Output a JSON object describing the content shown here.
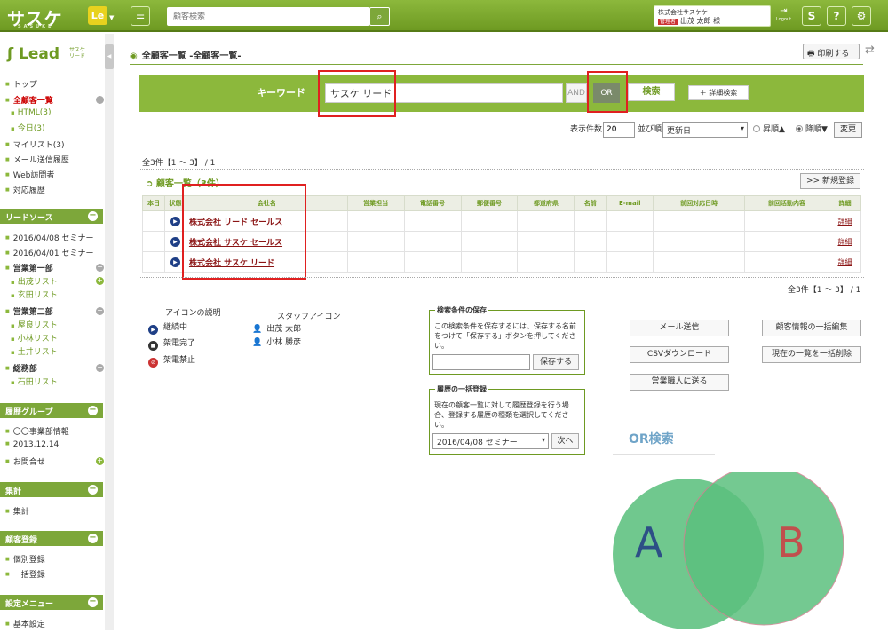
{
  "app": {
    "logo": "サスケ",
    "logo_sub": "SASUKE",
    "le_badge": "Le",
    "search_placeholder": "顧客検索"
  },
  "user": {
    "company": "株式会社サスケケ",
    "role_badge": "管理者",
    "name": "出茂 太郎 様",
    "logout": "Logout"
  },
  "top_icons": [
    "S",
    "?",
    "⚙"
  ],
  "sidebar": {
    "lead_logo": "Lead",
    "lead_logo_sub": "サスケ リード",
    "items": [
      {
        "label": "トップ"
      },
      {
        "label": "全顧客一覧"
      },
      {
        "label": "HTML(3)"
      },
      {
        "label": "今日(3)"
      },
      {
        "label": "マイリスト(3)"
      },
      {
        "label": "メール送信履歴"
      },
      {
        "label": "Web訪問者"
      },
      {
        "label": "対応履歴"
      }
    ],
    "sections": [
      {
        "title": "リードソース",
        "items": [
          "2016/04/08 セミナー",
          "2016/04/01 セミナー",
          "営業第一部",
          "出茂リスト",
          "玄田リスト",
          "営業第二部",
          "屋良リスト",
          "小林リスト",
          "土井リスト",
          "総務部",
          "石田リスト"
        ]
      },
      {
        "title": "履歴グループ",
        "items": [
          "〇〇事業部情報",
          "2013.12.14",
          "お問合せ"
        ]
      },
      {
        "title": "集計",
        "items": [
          "集計"
        ]
      },
      {
        "title": "顧客登録",
        "items": [
          "個別登録",
          "一括登録"
        ]
      },
      {
        "title": "設定メニュー",
        "items": [
          "基本設定"
        ]
      }
    ]
  },
  "page": {
    "title": "全顧客一覧 -全顧客一覧-",
    "print": "印刷する"
  },
  "search": {
    "label": "キーワード",
    "value": "サスケ リード",
    "and": "AND",
    "or": "OR",
    "submit": "検索",
    "advanced": "＋ 詳細検索"
  },
  "options": {
    "count_label": "表示件数",
    "count_value": "20",
    "sort_label": "並び順",
    "sort_value": "更新日",
    "asc": "昇順▲",
    "desc": "降順▼",
    "change": "変更"
  },
  "summary_top": "全3件【1 ～ 3】 / 1",
  "summary_bottom": "全3件【1 ～ 3】 / 1",
  "list": {
    "title": "顧客一覧（3件）",
    "new_button": ">> 新規登録",
    "columns": [
      "本日",
      "状態",
      "会社名",
      "営業担当",
      "電話番号",
      "郵便番号",
      "都道府県",
      "名前",
      "E-mail",
      "前回対応日時",
      "前回活動内容",
      "詳細"
    ],
    "rows": [
      {
        "company": "株式会社 リード セールス",
        "detail": "詳細"
      },
      {
        "company": "株式会社 サスケ セールス",
        "detail": "詳細"
      },
      {
        "company": "株式会社 サスケ リード",
        "detail": "詳細"
      }
    ]
  },
  "legend": {
    "title": "アイコンの説明",
    "items": [
      "継続中",
      "架電完了",
      "架電禁止"
    ],
    "staff_title": "スタッフアイコン",
    "staff": [
      "出茂 太郎",
      "小林 勝彦"
    ]
  },
  "save_condition": {
    "title": "検索条件の保存",
    "desc": "この検索条件を保存するには、保存する名前をつけて「保存する」ボタンを押してください。",
    "button": "保存する"
  },
  "bulk_history": {
    "title": "履歴の一括登録",
    "desc": "現在の顧客一覧に対して履歴登録を行う場合、登録する履歴の種類を選択してください。",
    "select": "2016/04/08 セミナー",
    "button": "次へ"
  },
  "actions": [
    "メール送信",
    "CSVダウンロード",
    "営業職人に送る",
    "顧客情報の一括編集",
    "現在の一覧を一括削除"
  ],
  "venn": {
    "title": "OR検索",
    "a": "A",
    "b": "B",
    "colors": {
      "fill": "#5cc07e",
      "a": "#2d4f86",
      "b": "#c0504d"
    }
  }
}
